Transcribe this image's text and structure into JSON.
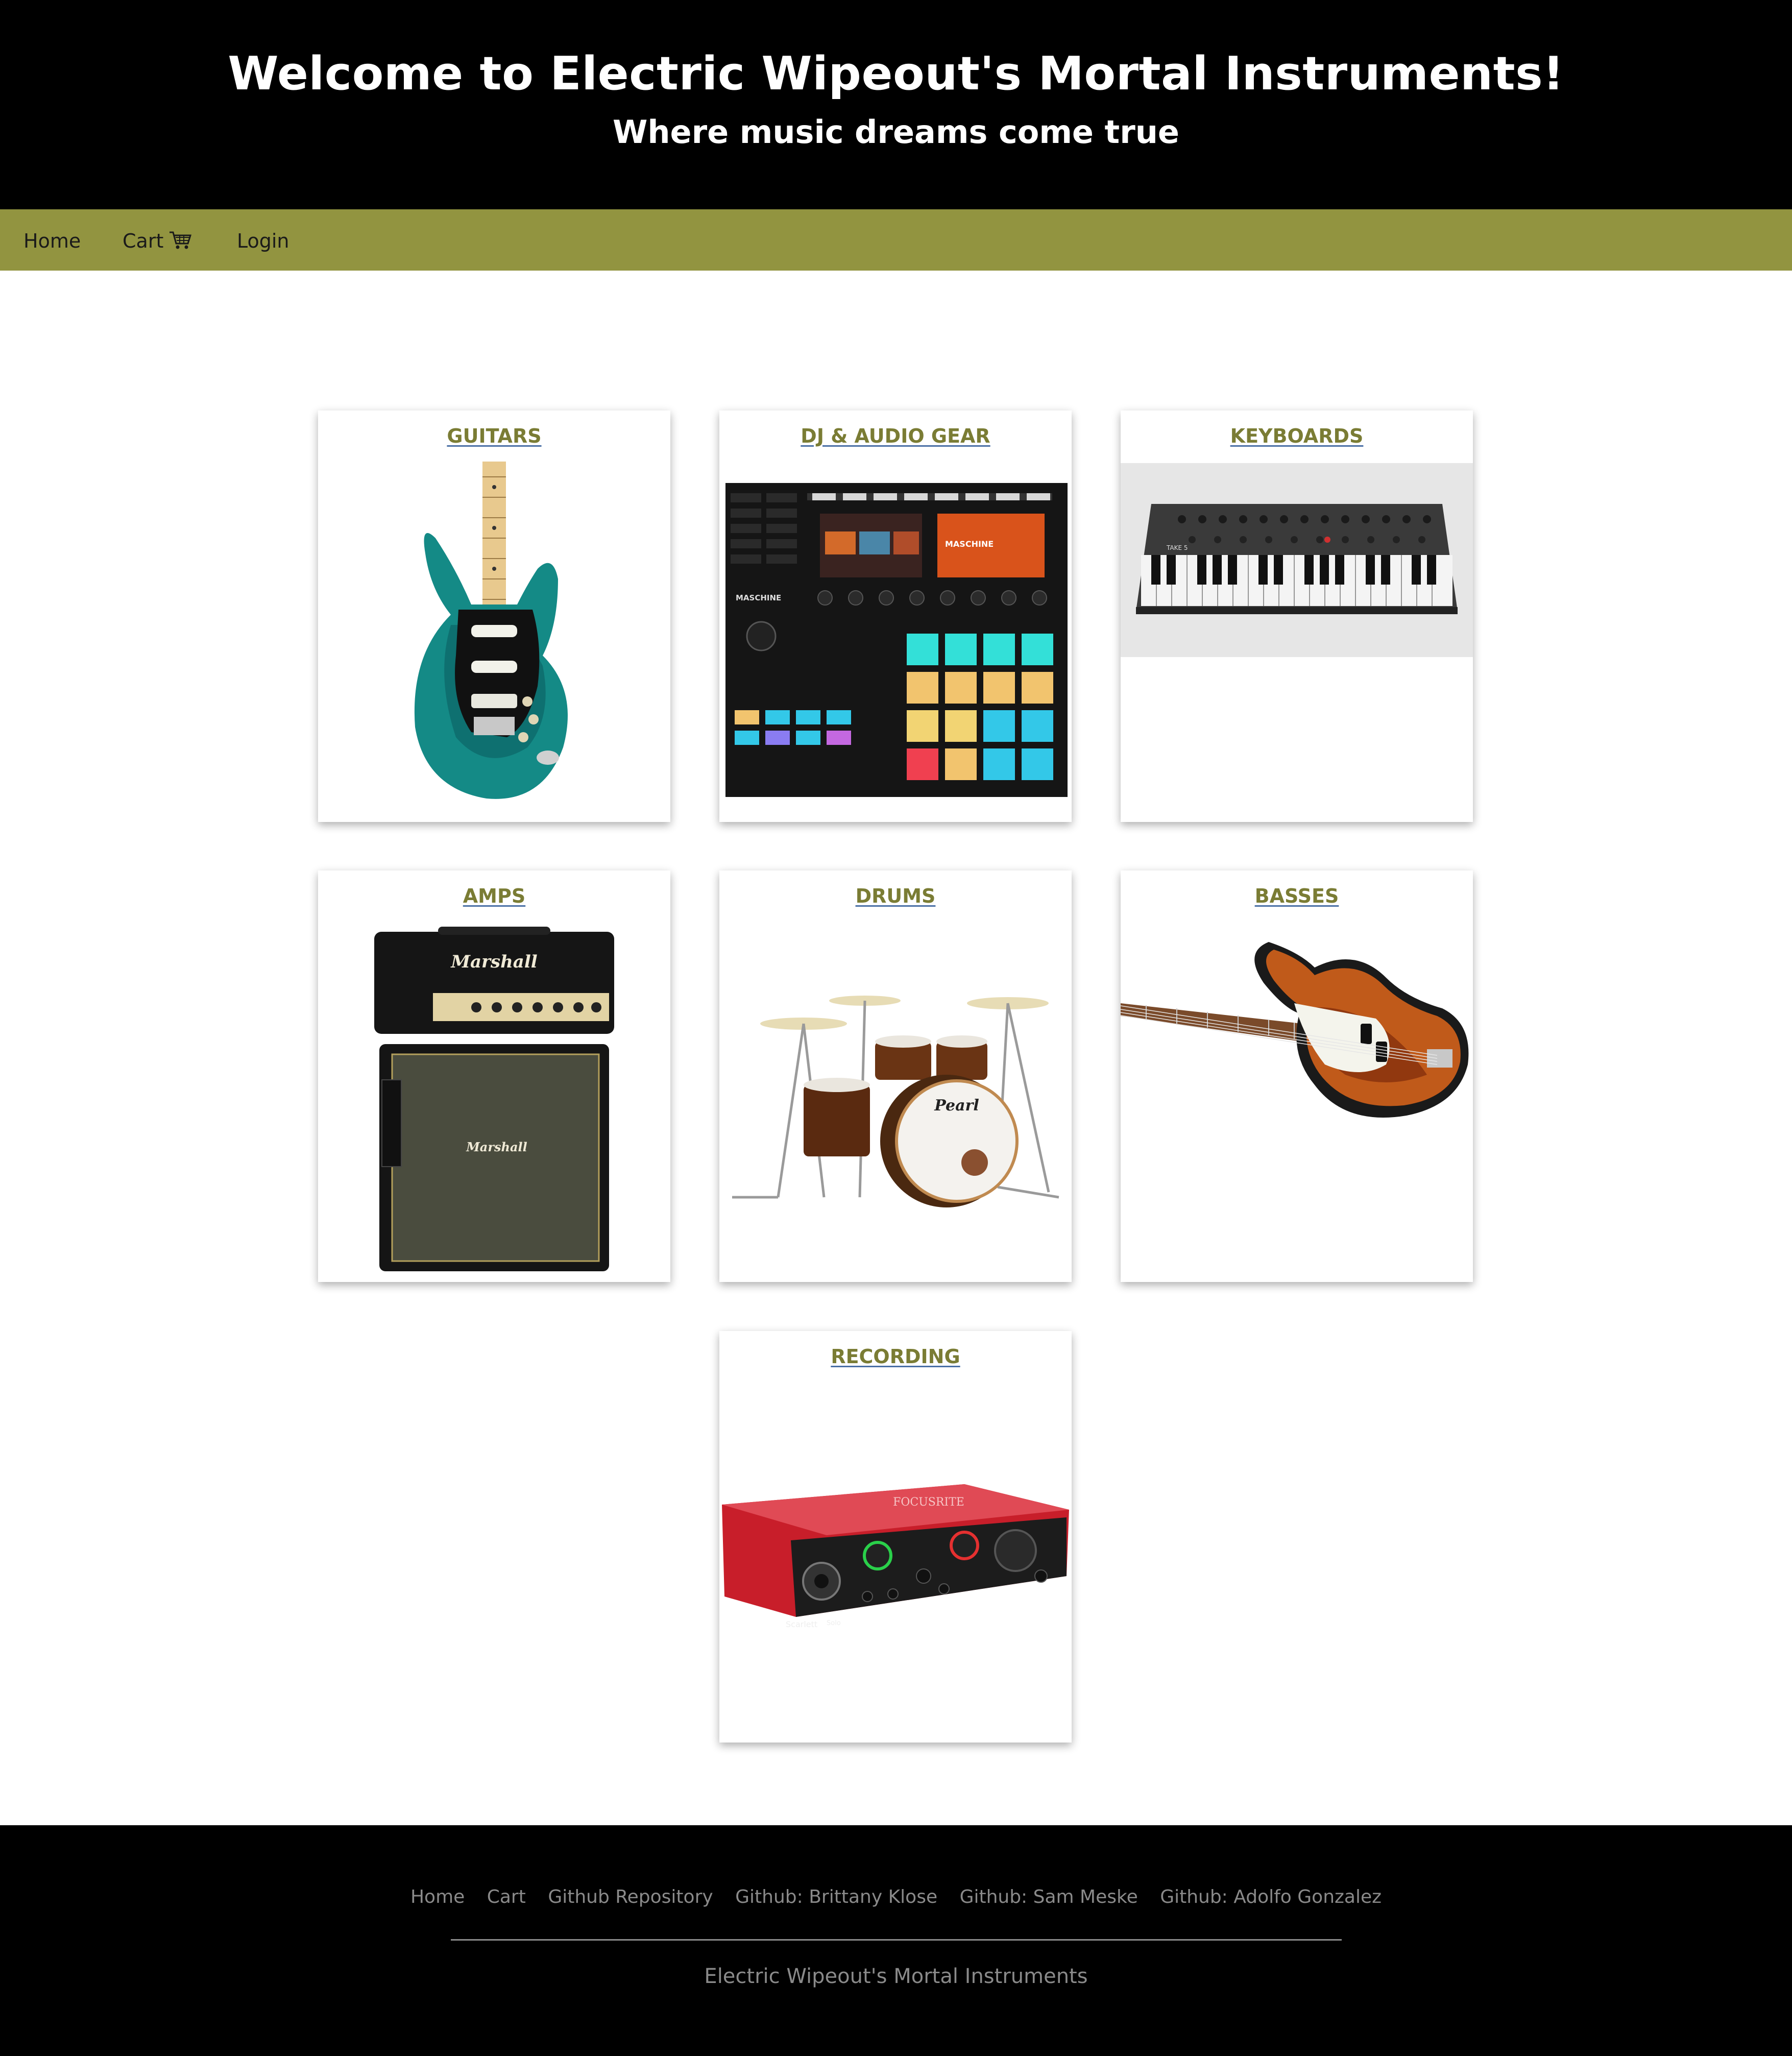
{
  "header": {
    "title": "Welcome to Electric Wipeout's Mortal Instruments!",
    "subtitle": "Where music dreams come true"
  },
  "nav": {
    "items": [
      {
        "label": "Home"
      },
      {
        "label": "Cart",
        "icon": "cart-icon"
      },
      {
        "label": "Login"
      }
    ],
    "background": "#929440"
  },
  "categories": [
    {
      "label": "GUITARS",
      "image": "electric-guitar"
    },
    {
      "label": "DJ & AUDIO GEAR",
      "image": "maschine-controller"
    },
    {
      "label": "KEYBOARDS",
      "image": "synthesizer"
    },
    {
      "label": "AMPS",
      "image": "marshall-amp-stack"
    },
    {
      "label": "DRUMS",
      "image": "pearl-drum-kit"
    },
    {
      "label": "BASSES",
      "image": "bass-guitar"
    },
    {
      "label": "RECORDING",
      "image": "audio-interface"
    }
  ],
  "images": {
    "amp_brand": "Marshall",
    "drum_brand": "Pearl",
    "maschine_brand": "MASCHINE",
    "interface_brand": "FOCUSRITE",
    "interface_model": "Scarlett",
    "interface_model_num": "Solo",
    "synth_brand": "TAKE 5"
  },
  "footer": {
    "links": [
      {
        "label": "Home"
      },
      {
        "label": "Cart"
      },
      {
        "label": "Github Repository"
      },
      {
        "label": "Github: Brittany Klose"
      },
      {
        "label": "Github: Sam Meske"
      },
      {
        "label": "Github: Adolfo Gonzalez"
      }
    ],
    "copyright": "Electric Wipeout's Mortal Instruments"
  },
  "colors": {
    "header_bg": "#000000",
    "card_title": "#7a7c34",
    "footer_text": "#8a8a8a"
  }
}
